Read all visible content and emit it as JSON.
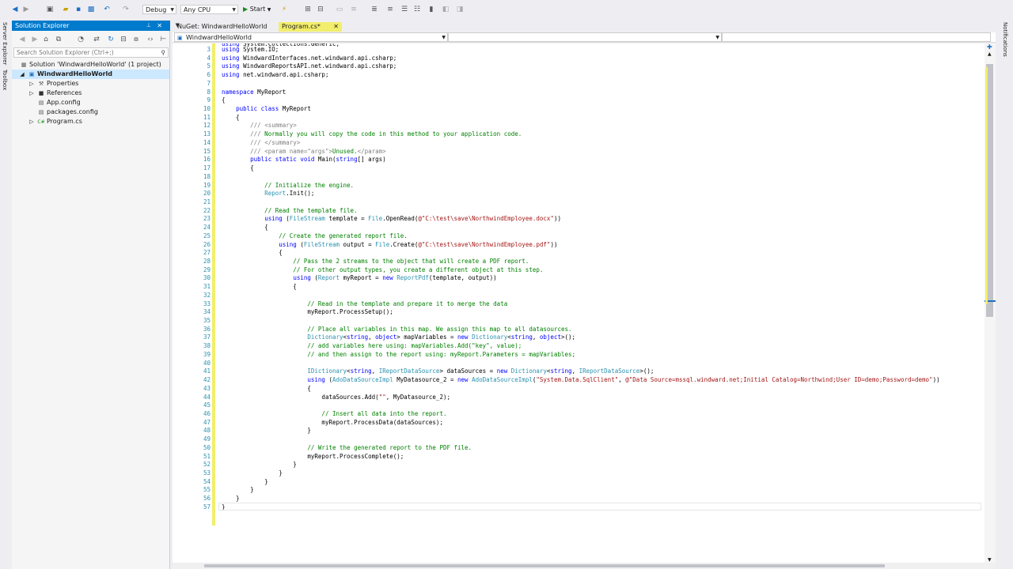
{
  "toolbar": {
    "config": "Debug",
    "platform": "Any CPU",
    "start_label": "Start"
  },
  "left_tabs": [
    "Server Explorer",
    "Toolbox"
  ],
  "right_tabs": [
    "Notifications"
  ],
  "solution_explorer": {
    "title": "Solution Explorer",
    "search_placeholder": "Search Solution Explorer (Ctrl+;)",
    "items": [
      {
        "label": "Solution 'WindwardHelloWorld' (1 project)",
        "icon": "solution-icon"
      },
      {
        "label": "WindwardHelloWorld",
        "icon": "csharp-project-icon"
      },
      {
        "label": "Properties",
        "icon": "wrench-icon"
      },
      {
        "label": "References",
        "icon": "references-icon"
      },
      {
        "label": "App.config",
        "icon": "config-file-icon"
      },
      {
        "label": "packages.config",
        "icon": "config-file-icon"
      },
      {
        "label": "Program.cs",
        "icon": "csharp-file-icon"
      }
    ]
  },
  "doc_tabs": [
    {
      "label": "NuGet: WindwardHelloWorld"
    },
    {
      "label": "Program.cs*"
    }
  ],
  "navbar": {
    "project": "WindwardHelloWorld"
  },
  "code_lines": [
    {
      "n": "3",
      "t": "using System.IO;"
    },
    {
      "n": "4",
      "t": "using WindwardInterfaces.net.windward.api.csharp;"
    },
    {
      "n": "5",
      "t": "using WindwardReportsAPI.net.windward.api.csharp;"
    },
    {
      "n": "6",
      "t": "using net.windward.api.csharp;"
    },
    {
      "n": "7",
      "t": ""
    },
    {
      "n": "8",
      "t": "namespace MyReport"
    },
    {
      "n": "9",
      "t": "{"
    },
    {
      "n": "10",
      "t": "    public class MyReport"
    },
    {
      "n": "11",
      "t": "    {"
    },
    {
      "n": "12",
      "t": "        /// <summary>"
    },
    {
      "n": "13",
      "t": "        /// Normally you will copy the code in this method to your application code."
    },
    {
      "n": "14",
      "t": "        /// </summary>"
    },
    {
      "n": "15",
      "t": "        /// <param name=\"args\">Unused.</param>"
    },
    {
      "n": "16",
      "t": "        public static void Main(string[] args)"
    },
    {
      "n": "17",
      "t": "        {"
    },
    {
      "n": "18",
      "t": ""
    },
    {
      "n": "19",
      "t": "            // Initialize the engine."
    },
    {
      "n": "20",
      "t": "            Report.Init();"
    },
    {
      "n": "21",
      "t": ""
    },
    {
      "n": "22",
      "t": "            // Read the template file."
    },
    {
      "n": "23",
      "t": "            using (FileStream template = File.OpenRead(@\"C:\\test\\save\\NorthwindEmployee.docx\"))"
    },
    {
      "n": "24",
      "t": "            {"
    },
    {
      "n": "25",
      "t": "                // Create the generated report file."
    },
    {
      "n": "26",
      "t": "                using (FileStream output = File.Create(@\"C:\\test\\save\\NorthwindEmployee.pdf\"))"
    },
    {
      "n": "27",
      "t": "                {"
    },
    {
      "n": "28",
      "t": "                    // Pass the 2 streams to the object that will create a PDF report."
    },
    {
      "n": "29",
      "t": "                    // For other output types, you create a different object at this step."
    },
    {
      "n": "30",
      "t": "                    using (Report myReport = new ReportPdf(template, output))"
    },
    {
      "n": "31",
      "t": "                    {"
    },
    {
      "n": "32",
      "t": ""
    },
    {
      "n": "33",
      "t": "                        // Read in the template and prepare it to merge the data"
    },
    {
      "n": "34",
      "t": "                        myReport.ProcessSetup();"
    },
    {
      "n": "35",
      "t": ""
    },
    {
      "n": "36",
      "t": "                        // Place all variables in this map. We assign this map to all datasources."
    },
    {
      "n": "37",
      "t": "                        Dictionary<string, object> mapVariables = new Dictionary<string, object>();"
    },
    {
      "n": "38",
      "t": "                        // add variables here using: mapVariables.Add(\"key\", value);"
    },
    {
      "n": "39",
      "t": "                        // and then assign to the report using: myReport.Parameters = mapVariables;"
    },
    {
      "n": "40",
      "t": ""
    },
    {
      "n": "41",
      "t": "                        IDictionary<string, IReportDataSource> dataSources = new Dictionary<string, IReportDataSource>();"
    },
    {
      "n": "42",
      "t": "                        using (AdoDataSourceImpl MyDatasource_2 = new AdoDataSourceImpl(\"System.Data.SqlClient\", @\"Data Source=mssql.windward.net;Initial Catalog=Northwind;User ID=demo;Password=demo\"))"
    },
    {
      "n": "43",
      "t": "                        {"
    },
    {
      "n": "44",
      "t": "                            dataSources.Add(\"\", MyDatasource_2);"
    },
    {
      "n": "45",
      "t": ""
    },
    {
      "n": "46",
      "t": "                            // Insert all data into the report."
    },
    {
      "n": "47",
      "t": "                            myReport.ProcessData(dataSources);"
    },
    {
      "n": "48",
      "t": "                        }"
    },
    {
      "n": "49",
      "t": ""
    },
    {
      "n": "50",
      "t": "                        // Write the generated report to the PDF file."
    },
    {
      "n": "51",
      "t": "                        myReport.ProcessComplete();"
    },
    {
      "n": "52",
      "t": "                    }"
    },
    {
      "n": "53",
      "t": "                }"
    },
    {
      "n": "54",
      "t": "            }"
    },
    {
      "n": "55",
      "t": "        }"
    },
    {
      "n": "56",
      "t": "    }"
    },
    {
      "n": "57",
      "t": "}"
    }
  ]
}
